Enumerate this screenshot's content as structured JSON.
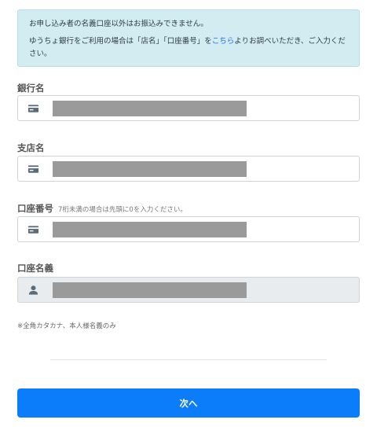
{
  "notice": {
    "line1": "お申し込み者の名義口座以外はお振込みできません。",
    "line2_before": "ゆうちょ銀行をご利用の場合は「店名」「口座番号」を",
    "line2_link": "こちら",
    "line2_after": "よりお調べいただき、ご入力ください。"
  },
  "fields": {
    "bank_name": {
      "label": "銀行名",
      "value": "",
      "icon": "card-icon"
    },
    "branch_name": {
      "label": "支店名",
      "value": "",
      "icon": "card-icon"
    },
    "account_number": {
      "label": "口座番号",
      "hint": "7桁未満の場合は先頭に0を入力ください。",
      "value": "",
      "icon": "card-icon"
    },
    "account_holder": {
      "label": "口座名義",
      "value": "",
      "icon": "user-icon",
      "readonly": true
    }
  },
  "note": "※全角カタカナ、本人様名義のみ",
  "next_button": "次へ",
  "colors": {
    "accent": "#0b7dfa",
    "notice_bg": "#d3ecf1",
    "link": "#1a73e8"
  }
}
